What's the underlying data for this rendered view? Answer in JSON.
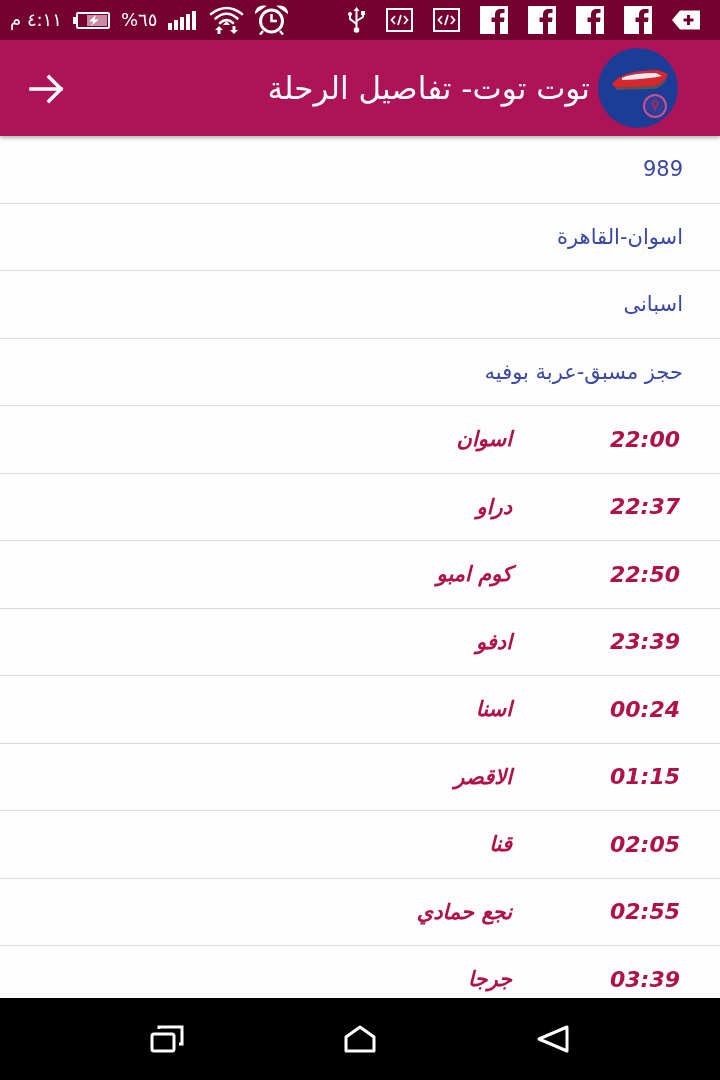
{
  "status_bar": {
    "time": "٤:١١ م",
    "battery": "%٦٥"
  },
  "app_bar": {
    "title": "توت توت- تفاصيل الرحلة"
  },
  "rows": [
    {
      "kind": "info",
      "text": "989"
    },
    {
      "kind": "info",
      "text": "اسوان-القاهرة"
    },
    {
      "kind": "info",
      "text": "اسبانى"
    },
    {
      "kind": "info",
      "text": "حجز مسبق-عربة بوفيه"
    },
    {
      "kind": "stop",
      "time": "22:00",
      "station": "اسوان"
    },
    {
      "kind": "stop",
      "time": "22:37",
      "station": "دراو"
    },
    {
      "kind": "stop",
      "time": "22:50",
      "station": "كوم امبو"
    },
    {
      "kind": "stop",
      "time": "23:39",
      "station": "ادفو"
    },
    {
      "kind": "stop",
      "time": "00:24",
      "station": "اسنا"
    },
    {
      "kind": "stop",
      "time": "01:15",
      "station": "الاقصر"
    },
    {
      "kind": "stop",
      "time": "02:05",
      "station": "قنا"
    },
    {
      "kind": "stop",
      "time": "02:55",
      "station": "نجع حمادي"
    },
    {
      "kind": "stop",
      "time": "03:39",
      "station": "جرجا"
    }
  ]
}
